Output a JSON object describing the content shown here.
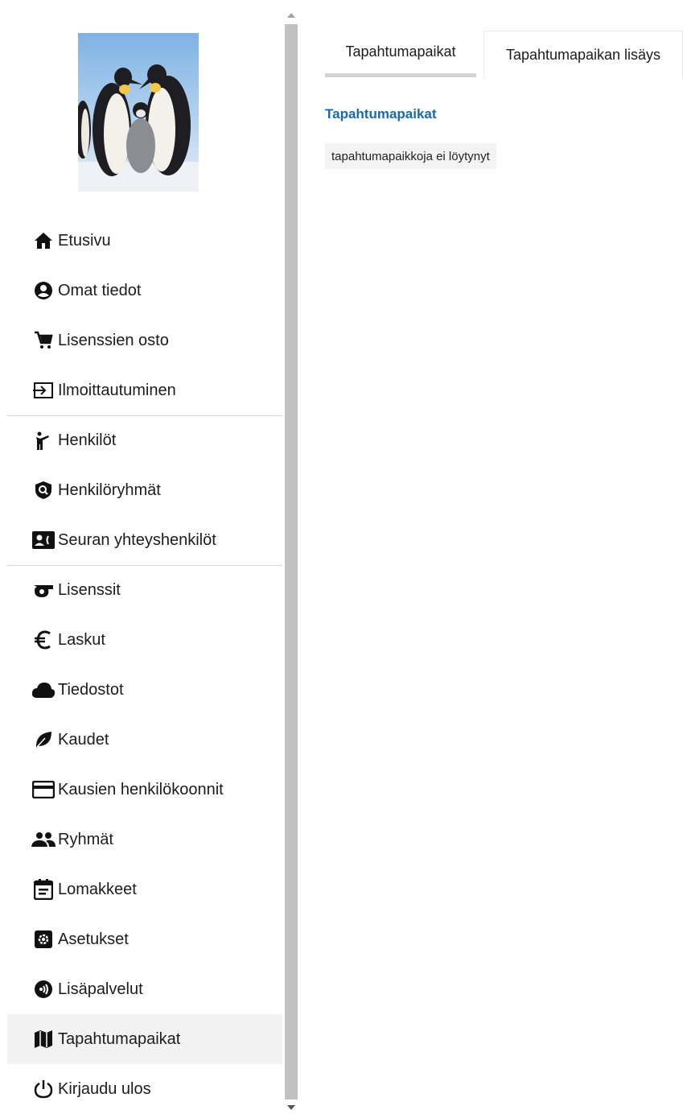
{
  "sidebar": {
    "logo_alt": "penguins-photo",
    "items": [
      {
        "label": "Etusivu",
        "icon": "home-icon"
      },
      {
        "label": "Omat tiedot",
        "icon": "account-circle-icon"
      },
      {
        "label": "Lisenssien osto",
        "icon": "cart-icon"
      },
      {
        "label": "Ilmoittautuminen",
        "icon": "login-icon"
      },
      {
        "label": "Henkilöt",
        "icon": "person-icon"
      },
      {
        "label": "Henkilöryhmät",
        "icon": "shield-search-icon"
      },
      {
        "label": "Seuran yhteyshenkilöt",
        "icon": "contact-card-icon"
      },
      {
        "label": "Lisenssit",
        "icon": "whistle-icon"
      },
      {
        "label": "Laskut",
        "icon": "euro-icon"
      },
      {
        "label": "Tiedostot",
        "icon": "cloud-icon"
      },
      {
        "label": "Kaudet",
        "icon": "leaf-icon"
      },
      {
        "label": "Kausien henkilökoonnit",
        "icon": "credit-card-icon"
      },
      {
        "label": "Ryhmät",
        "icon": "group-icon"
      },
      {
        "label": "Lomakkeet",
        "icon": "calendar-form-icon"
      },
      {
        "label": "Asetukset",
        "icon": "settings-icon"
      },
      {
        "label": "Lisäpalvelut",
        "icon": "broadcast-icon"
      },
      {
        "label": "Tapahtumapaikat",
        "icon": "map-icon",
        "active": true
      },
      {
        "label": "Kirjaudu ulos",
        "icon": "power-icon"
      }
    ]
  },
  "main": {
    "tabs": [
      {
        "label": "Tapahtumapaikat",
        "active": true
      },
      {
        "label": "Tapahtumapaikan lisäys",
        "active": false
      }
    ],
    "section_title": "Tapahtumapaikat",
    "empty_message": "tapahtumapaikkoja ei löytynyt"
  },
  "colors": {
    "accent_title": "#1a6aa8",
    "active_item_bg": "#f2f2f2"
  }
}
